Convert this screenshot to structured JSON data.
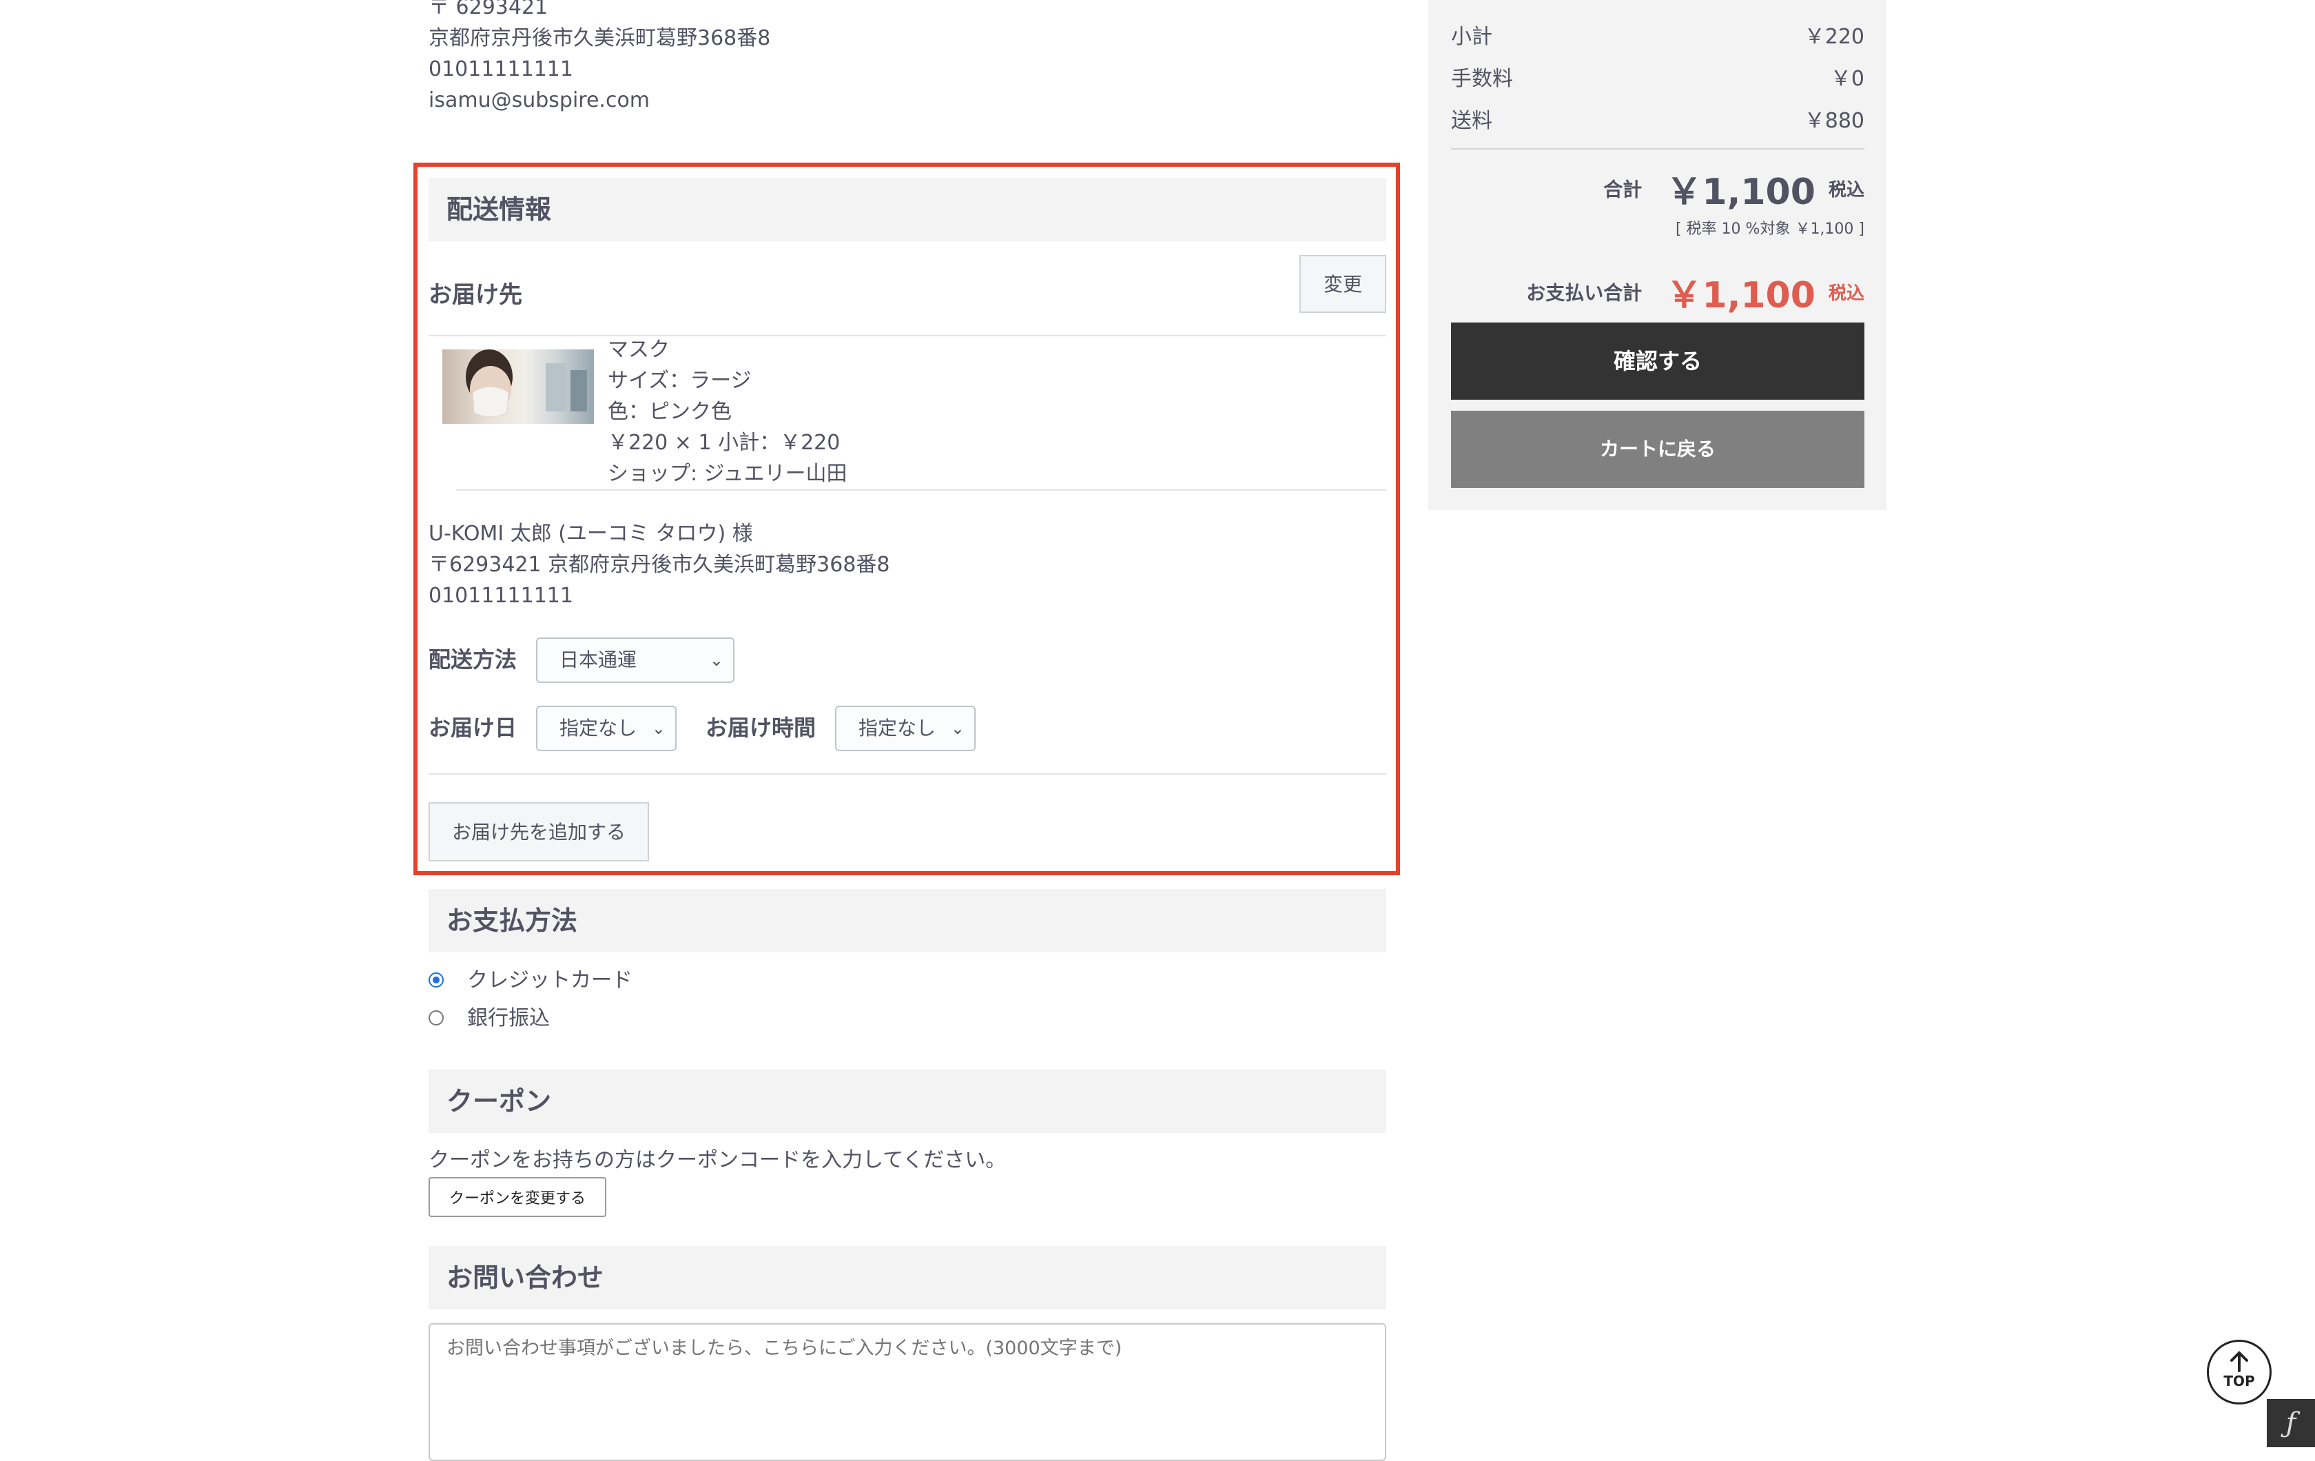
{
  "customer": {
    "postal": "〒 6293421",
    "address": "京都府京丹後市久美浜町葛野368番8",
    "phone": "01011111111",
    "email": "isamu@subspire.com"
  },
  "shipping": {
    "section_title": "配送情報",
    "destination_label": "お届け先",
    "change_button": "変更",
    "product": {
      "name": "マスク",
      "size": "サイズ：ラージ",
      "color": "色：ピンク色",
      "price_line": "￥220 × 1  小計：￥220",
      "shop": "ショップ: ジュエリー山田"
    },
    "recipient": {
      "name": "U-KOMI 太郎 (ユーコミ タロウ) 様",
      "address": "〒6293421 京都府京丹後市久美浜町葛野368番8",
      "phone": "01011111111"
    },
    "method_label": "配送方法",
    "method_value": "日本通運",
    "date_label": "お届け日",
    "date_value": "指定なし",
    "time_label": "お届け時間",
    "time_value": "指定なし",
    "add_destination_button": "お届け先を追加する"
  },
  "payment": {
    "section_title": "お支払方法",
    "options": [
      {
        "label": "クレジットカード",
        "selected": true
      },
      {
        "label": "銀行振込",
        "selected": false
      }
    ]
  },
  "coupon": {
    "section_title": "クーポン",
    "description": "クーポンをお持ちの方はクーポンコードを入力してください。",
    "button": "クーポンを変更する"
  },
  "inquiry": {
    "section_title": "お問い合わせ",
    "placeholder": "お問い合わせ事項がございましたら、こちらにご入力ください。(3000文字まで)"
  },
  "summary": {
    "subtotal_label": "小計",
    "subtotal_value": "￥220",
    "fee_label": "手数料",
    "fee_value": "￥0",
    "shipping_label": "送料",
    "shipping_value": "￥880",
    "total_label": "合計",
    "total_value": "￥1,100",
    "tax_incl": "税込",
    "tax_note": "[ 税率 10 %対象  ￥1,100 ]",
    "pay_total_label": "お支払い合計",
    "pay_total_value": "￥1,100",
    "confirm_button": "確認する",
    "back_button": "カートに戻る"
  },
  "page_top": {
    "label": "TOP"
  },
  "colors": {
    "accent_red": "#de5d50",
    "highlight_border": "#e8402a",
    "dark_button": "#333333",
    "gray_button": "#808080"
  },
  "icons": {
    "top_arrow": "arrow-up-icon",
    "select_chevron": "chevron-down-icon",
    "corner": "symfony-logo-icon"
  }
}
